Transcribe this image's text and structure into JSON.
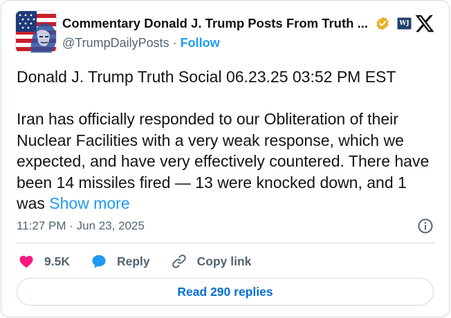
{
  "author": {
    "display_name": "Commentary Donald J. Trump Posts From Truth ...",
    "handle": "@TrumpDailyPosts",
    "separator": " · ",
    "follow_label": "Follow",
    "affiliate_badge_text": "WJ"
  },
  "tweet": {
    "line1": "Donald J. Trump Truth Social 06.23.25 03:52 PM EST",
    "line2": "Iran has officially responded to our Obliteration of their Nuclear Facilities with a very weak response, which we expected, and have very effectively countered. There have been 14 missiles fired — 13 were knocked down, and 1 was ",
    "show_more": "Show more",
    "timestamp": "11:27 PM · Jun 23, 2025"
  },
  "actions": {
    "like_count": "9.5K",
    "reply_label": "Reply",
    "copy_link_label": "Copy link",
    "read_replies_label": "Read 290 replies"
  },
  "icons": [
    "avatar-flag",
    "verified-badge",
    "affiliate-badge",
    "x-logo",
    "info-icon",
    "heart-icon",
    "reply-icon",
    "link-icon"
  ],
  "colors": {
    "accent": "#1d9bf0",
    "like": "#f91880",
    "muted": "#536471",
    "verified_gold": "#e8b02a"
  }
}
